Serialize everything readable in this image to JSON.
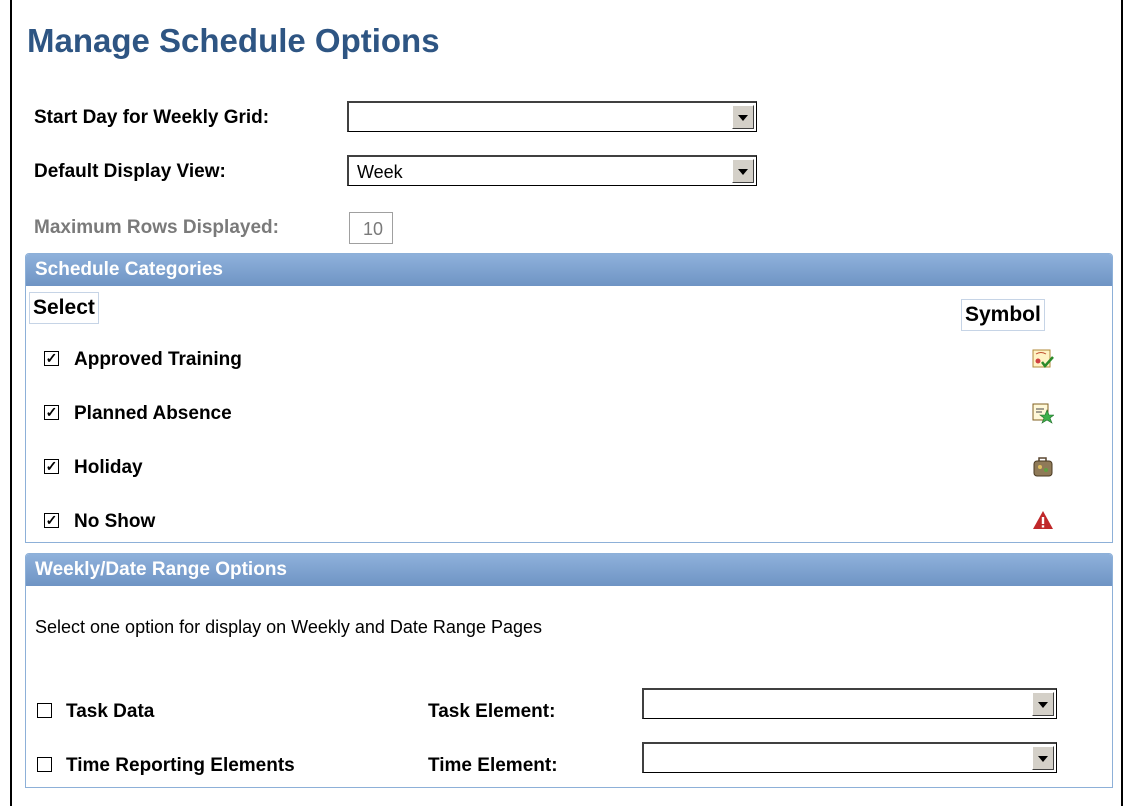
{
  "page": {
    "title": "Manage Schedule Options"
  },
  "fields": {
    "start_day_label": "Start Day for Weekly Grid:",
    "start_day_value": "",
    "default_view_label": "Default Display View:",
    "default_view_value": "Week",
    "max_rows_label": "Maximum Rows Displayed:",
    "max_rows_value": "10"
  },
  "schedule_categories": {
    "header": "Schedule Categories",
    "col_select": "Select",
    "col_symbol": "Symbol",
    "items": [
      {
        "label": "Approved Training",
        "checked": true,
        "icon": "certificate-check-icon"
      },
      {
        "label": "Planned Absence",
        "checked": true,
        "icon": "calendar-star-icon"
      },
      {
        "label": "Holiday",
        "checked": true,
        "icon": "suitcase-icon"
      },
      {
        "label": "No Show",
        "checked": true,
        "icon": "warning-triangle-icon"
      }
    ]
  },
  "weekly_options": {
    "header": "Weekly/Date Range Options",
    "instructions": "Select one option for display on Weekly and Date Range Pages",
    "task_data_label": "Task Data",
    "task_data_checked": false,
    "task_element_label": "Task Element:",
    "task_element_value": "",
    "time_reporting_label": "Time Reporting Elements",
    "time_reporting_checked": false,
    "time_element_label": "Time Element:",
    "time_element_value": ""
  },
  "colors": {
    "title": "#2e5583",
    "group_header": "#7c9ece",
    "no_show_icon": "#c0282a"
  }
}
